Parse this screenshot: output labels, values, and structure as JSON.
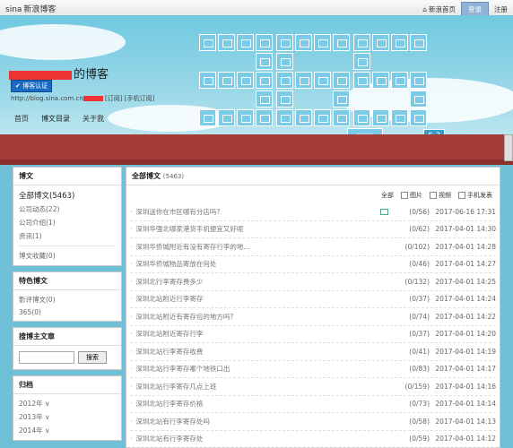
{
  "topbar": {
    "logo": "sina",
    "logo_sub": "新浪博客",
    "home_label": "新浪首页",
    "login_label": "登录",
    "register_label": "注册"
  },
  "header": {
    "title_suffix": "的博客",
    "verify": "博客认证",
    "url": "http://blog.sina.com.cn",
    "subscribe": "[订阅]",
    "mobile_subscribe": "[手机订阅]",
    "nav": [
      "首页",
      "博文目录",
      "关于我"
    ],
    "tile_link": "延迟阅",
    "badge_digits": "6 3",
    "badge_num": "@365"
  },
  "sidebar": {
    "posts_title": "博文",
    "posts": [
      {
        "label": "全部博文",
        "count": "(5463)"
      },
      {
        "label": "公司动态",
        "count": "(22)"
      },
      {
        "label": "公司介绍",
        "count": "(1)"
      },
      {
        "label": "资讯",
        "count": "(1)"
      }
    ],
    "collect": "博文收藏(0)",
    "featured_title": "特色博文",
    "featured": [
      "影评博文(0)",
      "365(0)"
    ],
    "search_title": "搜博主文章",
    "search_button": "搜索",
    "archive_title": "归档",
    "archive": [
      "2012年",
      "2013年",
      "2014年"
    ]
  },
  "content": {
    "title": "全部博文",
    "count": "(5463)",
    "filters": [
      "全部",
      "图片",
      "视频",
      "手机发表"
    ],
    "rows": [
      {
        "title": "深圳送你在市区哪有分店吗?",
        "count": "(0/56)",
        "time": "2017-06-16 17:31",
        "img": true
      },
      {
        "title": "深圳华强北哪家港货手机便宜又好呢",
        "count": "(0/62)",
        "time": "2017-04-01 14:30"
      },
      {
        "title": "深圳华侨城附近有没有寄存行李的地...",
        "count": "(0/102)",
        "time": "2017-04-01 14:28"
      },
      {
        "title": "深圳华侨城物品寄放在何处",
        "count": "(0/46)",
        "time": "2017-04-01 14:27"
      },
      {
        "title": "深圳北行李寄存费多少",
        "count": "(0/132)",
        "time": "2017-04-01 14:25"
      },
      {
        "title": "深圳北站附近行李寄存",
        "count": "(0/37)",
        "time": "2017-04-01 14:24"
      },
      {
        "title": "深圳北站附近有寄存包的地方吗?",
        "count": "(0/74)",
        "time": "2017-04-01 14:22"
      },
      {
        "title": "深圳北站附近寄存行李",
        "count": "(0/37)",
        "time": "2017-04-01 14:20"
      },
      {
        "title": "深圳北站行李寄存收费",
        "count": "(0/41)",
        "time": "2017-04-01 14:19"
      },
      {
        "title": "深圳北站行李寄存哪个地铁口出",
        "count": "(0/83)",
        "time": "2017-04-01 14:17"
      },
      {
        "title": "深圳北站行李寄存几点上班",
        "count": "(0/159)",
        "time": "2017-04-01 14:16"
      },
      {
        "title": "深圳北站行李寄存价格",
        "count": "(0/73)",
        "time": "2017-04-01 14:14"
      },
      {
        "title": "深圳北站有行李寄存处吗",
        "count": "(0/58)",
        "time": "2017-04-01 14:13"
      },
      {
        "title": "深圳北站有行李寄存处",
        "count": "(0/59)",
        "time": "2017-04-01 14:12"
      }
    ]
  }
}
